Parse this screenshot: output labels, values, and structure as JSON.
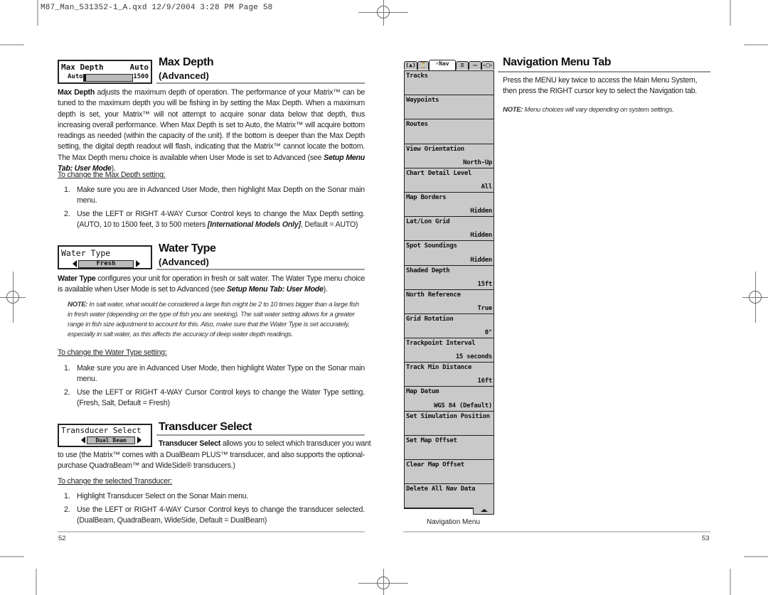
{
  "slug": "M87_Man_531352-1_A.qxd  12/9/2004  3:28 PM  Page 58",
  "left_page": {
    "page_number": "52",
    "max_depth": {
      "widget": {
        "label": "Max Depth",
        "value": "Auto",
        "min_label": "Auto",
        "max_label": "1500",
        "slider_fraction": 0.0
      },
      "title": "Max Depth",
      "subtitle": "(Advanced)",
      "body_lead": "Max Depth",
      "body": " adjusts the maximum depth of operation. The performance of your Matrix™ can be tuned to the maximum depth you will be fishing in by setting the Max Depth. When a maximum depth is set, your Matrix™ will not attempt to acquire sonar data below that depth, thus increasing overall performance. When Max Depth is set to Auto, the Matrix™ will acquire bottom readings as needed (within the capacity of the unit). If the bottom is deeper than the Max Depth setting, the digital depth readout will flash, indicating that the Matrix™ cannot locate the bottom. The Max Depth menu choice is available when User Mode is set to Advanced (see ",
      "body_ref": "Setup Menu Tab: User Mode",
      "body_end": ").",
      "steps_heading": "To change the Max Depth setting:",
      "steps": [
        {
          "n": "1.",
          "text": "Make sure you are in Advanced User Mode, then highlight Max Depth on the Sonar main menu."
        },
        {
          "n": "2.",
          "text": "Use the LEFT or RIGHT 4-WAY Cursor Control keys to change the Max Depth setting. (AUTO, 10 to 1500 feet, 3 to 500 meters ",
          "emph": "[International Models Only]",
          "tail": ", Default = AUTO)"
        }
      ]
    },
    "water_type": {
      "widget": {
        "label": "Water Type",
        "value": "Fresh"
      },
      "title": "Water Type",
      "subtitle": "(Advanced)",
      "body_lead": "Water Type",
      "body": " configures your unit for operation in fresh or salt water. The Water Type menu choice is available when User Mode is set to Advanced (see ",
      "body_ref": "Setup Menu Tab: User Mode",
      "body_end": ").",
      "note_lead": "NOTE:",
      "note": " In salt water, what would be considered a large fish might be 2 to 10 times bigger than a large fish in fresh water (depending on the type of fish you are seeking).  The salt water setting allows for a greater range in fish size adjustment to account for this.  Also, make sure that the Water Type is set accurately, especially in salt water, as this affects the accuracy of deep water depth readings.",
      "steps_heading": "To change the Water Type setting:",
      "steps": [
        {
          "n": "1.",
          "text": "Make sure you are in Advanced User Mode, then highlight Water Type on the Sonar main menu."
        },
        {
          "n": "2.",
          "text": "Use the LEFT or RIGHT 4-WAY Cursor Control keys to change the Water Type setting. (Fresh, Salt, Default = Fresh)"
        }
      ]
    },
    "transducer_select": {
      "widget": {
        "label": "Transducer Select",
        "value": "Dual Beam"
      },
      "title": "Transducer Select",
      "body_lead": "Transducer Select",
      "body_line1": " allows you to select which transducer you want",
      "body_rest": "to use (the Matrix™ comes with a DualBeam PLUS™ transducer, and also supports the optional-purchase QuadraBeam™ and WideSide® transducers.)",
      "steps_heading": "To change the selected Transducer:",
      "steps": [
        {
          "n": "1.",
          "text": "Highlight Transducer Select on the Sonar Main menu."
        },
        {
          "n": "2.",
          "text": "Use the LEFT or RIGHT 4-WAY Cursor Control keys to change the transducer selected. (DualBeam, QuadraBeam, WideSide, Default = DualBeam)"
        }
      ]
    }
  },
  "right_page": {
    "page_number": "53",
    "title": "Navigation Menu Tab",
    "body": "Press the MENU key twice to access the Main Menu System, then press the RIGHT cursor key to select the Navigation tab.",
    "note_lead": "NOTE:",
    "note": " Menu choices will vary depending on system settings.",
    "caption": "Navigation Menu",
    "menu": {
      "tabs": [
        {
          "name": "sonar-tab",
          "label": "(▲)",
          "active": false
        },
        {
          "name": "alarms-tab",
          "label": "⏳",
          "active": false
        },
        {
          "name": "nav-tab",
          "label": "☼Nav",
          "active": true
        },
        {
          "name": "setup-tab",
          "label": "≡",
          "active": false
        },
        {
          "name": "views-tab",
          "label": "▭",
          "active": false
        },
        {
          "name": "accessories-tab",
          "label": "-□-",
          "active": false
        }
      ],
      "items": [
        {
          "label": "Tracks",
          "value": ""
        },
        {
          "label": "Waypoints",
          "value": ""
        },
        {
          "label": "Routes",
          "value": ""
        },
        {
          "label": "View Orientation",
          "value": "North-Up"
        },
        {
          "label": "Chart Detail Level",
          "value": "All"
        },
        {
          "label": "Map Borders",
          "value": "Hidden"
        },
        {
          "label": "Lat/Lon Grid",
          "value": "Hidden"
        },
        {
          "label": "Spot Soundings",
          "value": "Hidden"
        },
        {
          "label": "Shaded Depth",
          "value": "15ft"
        },
        {
          "label": "North Reference",
          "value": "True"
        },
        {
          "label": "Grid Rotation",
          "value": "0°"
        },
        {
          "label": "Trackpoint Interval",
          "value": "15 seconds"
        },
        {
          "label": "Track Min Distance",
          "value": "16ft"
        },
        {
          "label": "Map Datum",
          "value": "WGS 84 (Default)"
        },
        {
          "label": "Set Simulation Position",
          "value": ""
        },
        {
          "label": "Set Map Offset",
          "value": ""
        },
        {
          "label": "Clear Map Offset",
          "value": ""
        },
        {
          "label": "Delete All Nav Data",
          "value": ""
        }
      ]
    }
  }
}
